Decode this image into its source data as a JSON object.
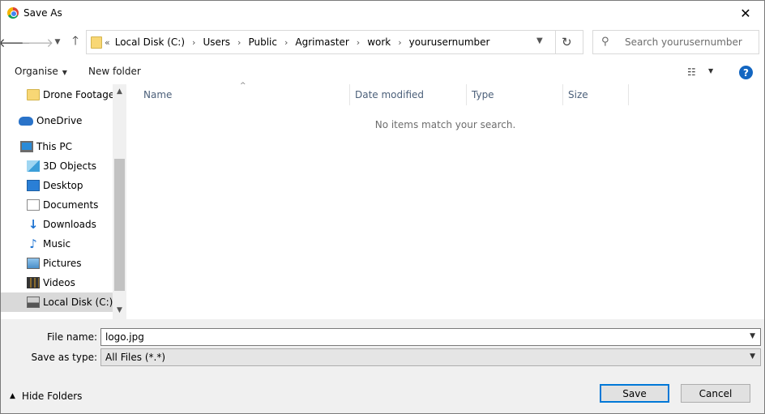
{
  "window": {
    "title": "Save As",
    "close_glyph": "✕"
  },
  "address": {
    "overflow": "«",
    "crumbs": [
      "Local Disk (C:)",
      "Users",
      "Public",
      "Agrimaster",
      "work",
      "yourusernumber"
    ],
    "search_placeholder": "Search yourusernumber"
  },
  "toolbar": {
    "organise": "Organise",
    "new_folder": "New folder",
    "help": "?"
  },
  "nav_pane": {
    "items": [
      {
        "label": "Drone Footage",
        "icon": "folder-icon"
      },
      {
        "label": "OneDrive",
        "icon": "onedrive-icon"
      },
      {
        "label": "This PC",
        "icon": "this-pc-icon"
      },
      {
        "label": "3D Objects",
        "icon": "3d-objects-icon"
      },
      {
        "label": "Desktop",
        "icon": "desktop-icon"
      },
      {
        "label": "Documents",
        "icon": "documents-icon"
      },
      {
        "label": "Downloads",
        "icon": "downloads-icon"
      },
      {
        "label": "Music",
        "icon": "music-icon"
      },
      {
        "label": "Pictures",
        "icon": "pictures-icon"
      },
      {
        "label": "Videos",
        "icon": "videos-icon"
      },
      {
        "label": "Local Disk (C:)",
        "icon": "local-disk-icon",
        "selected": true
      }
    ]
  },
  "file_list": {
    "columns": [
      "Name",
      "Date modified",
      "Type",
      "Size"
    ],
    "empty_message": "No items match your search."
  },
  "form": {
    "file_name_label": "File name:",
    "file_name_value": "logo.jpg",
    "save_as_type_label": "Save as type:",
    "save_as_type_value": "All Files (*.*)"
  },
  "footer": {
    "hide_folders": "Hide Folders",
    "save": "Save",
    "cancel": "Cancel"
  },
  "colors": {
    "accent": "#0078d7",
    "help_blue": "#1366c1",
    "header_text": "#4c607a",
    "selection": "#d9d9d9"
  }
}
